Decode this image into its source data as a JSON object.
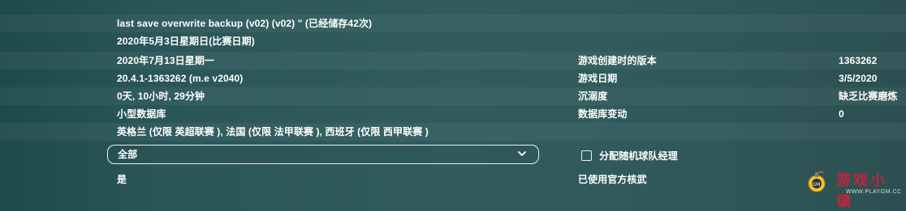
{
  "save": {
    "name": "last save overwrite backup (v02) (v02) \" (已经储存42次)",
    "game_date_full": "2020年5月3日星期日(比赛日期)"
  },
  "details": {
    "created_date": "2020年7月13日星期一",
    "created_version_label": "游戏创建时的版本",
    "created_version_value": "1363262",
    "version_string": "20.4.1-1363262 (m.e v2040)",
    "game_date_label": "游戏日期",
    "game_date_value": "3/5/2020",
    "playtime": "0天, 10小时, 29分钟",
    "addiction_label": "沉溺度",
    "addiction_value": "缺乏比赛磨炼",
    "database_size": "小型数据库",
    "database_changes_label": "数据库变动",
    "database_changes_value": "0",
    "leagues": "英格兰 (仅限 英超联赛 ), 法国 (仅限 法甲联赛 ), 西班牙 (仅限 西甲联赛 )"
  },
  "filter": {
    "selected": "全部",
    "icon": "chevron-down-icon"
  },
  "random_manager": {
    "label": "分配随机球队经理",
    "checked": false
  },
  "bottom": {
    "left_value": "是",
    "right_value": "已使用官方核武"
  },
  "watermark": {
    "title": "游戏小镇",
    "url": "WWW.PLAYGM.CC",
    "icon": "bomb-icon",
    "color": "#c4223a"
  },
  "colors": {
    "background": "#2e5759",
    "text": "#ffffff",
    "border": "#e8f0ef"
  }
}
